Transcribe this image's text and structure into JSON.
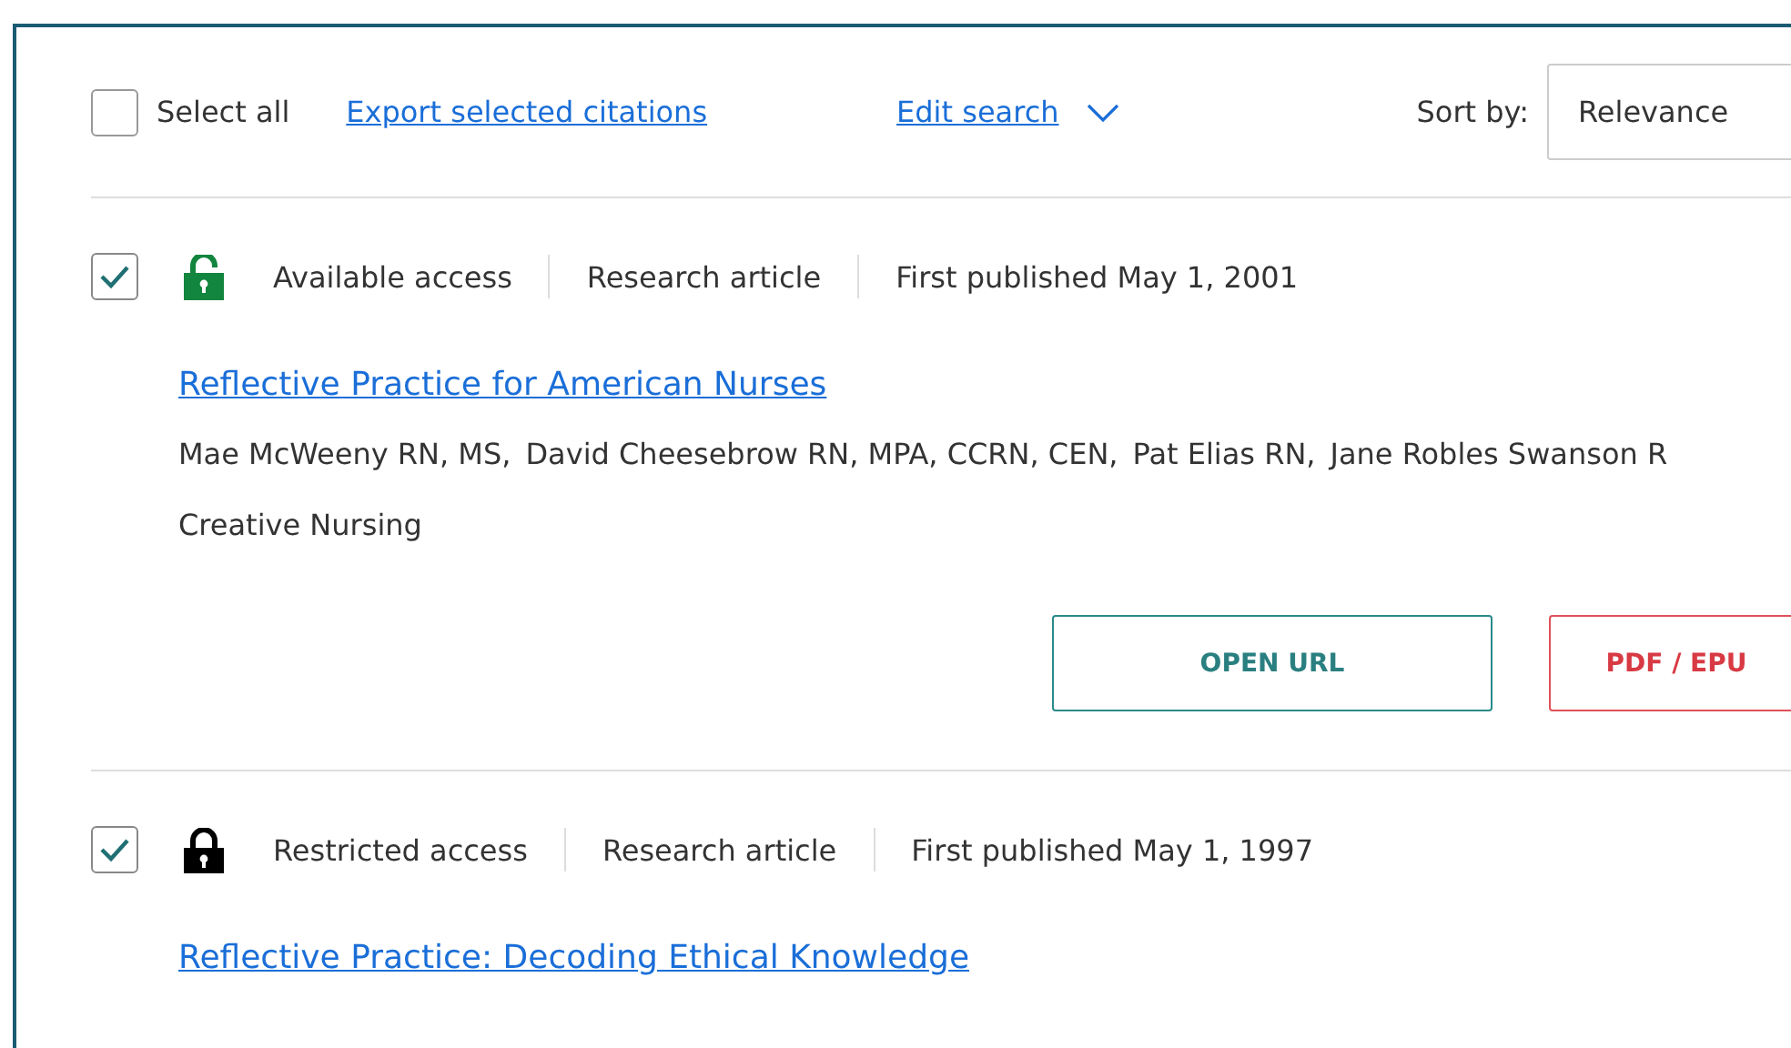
{
  "toolbar": {
    "select_all": {
      "label": "Select all",
      "checked": false
    },
    "export_link": "Export selected citations",
    "edit_search": "Edit search",
    "sort": {
      "label": "Sort by:",
      "value": "Relevance"
    }
  },
  "results": [
    {
      "selected": true,
      "access": {
        "kind": "available",
        "label": "Available access"
      },
      "type": "Research article",
      "published": "First published May 1, 2001",
      "title": "Reflective Practice for American Nurses",
      "authors": [
        "Mae McWeeny RN, MS,",
        "David Cheesebrow RN, MPA, CCRN, CEN,",
        "Pat Elias RN,",
        "Jane Robles Swanson R"
      ],
      "journal": "Creative Nursing",
      "buttons": [
        {
          "label": "OPEN URL",
          "kind": "primary"
        },
        {
          "label": "PDF / EPU",
          "kind": "danger"
        }
      ]
    },
    {
      "selected": true,
      "access": {
        "kind": "restricted",
        "label": "Restricted access"
      },
      "type": "Research article",
      "published": "First published May 1, 1997",
      "title": "Reflective Practice: Decoding Ethical Knowledge"
    }
  ]
}
